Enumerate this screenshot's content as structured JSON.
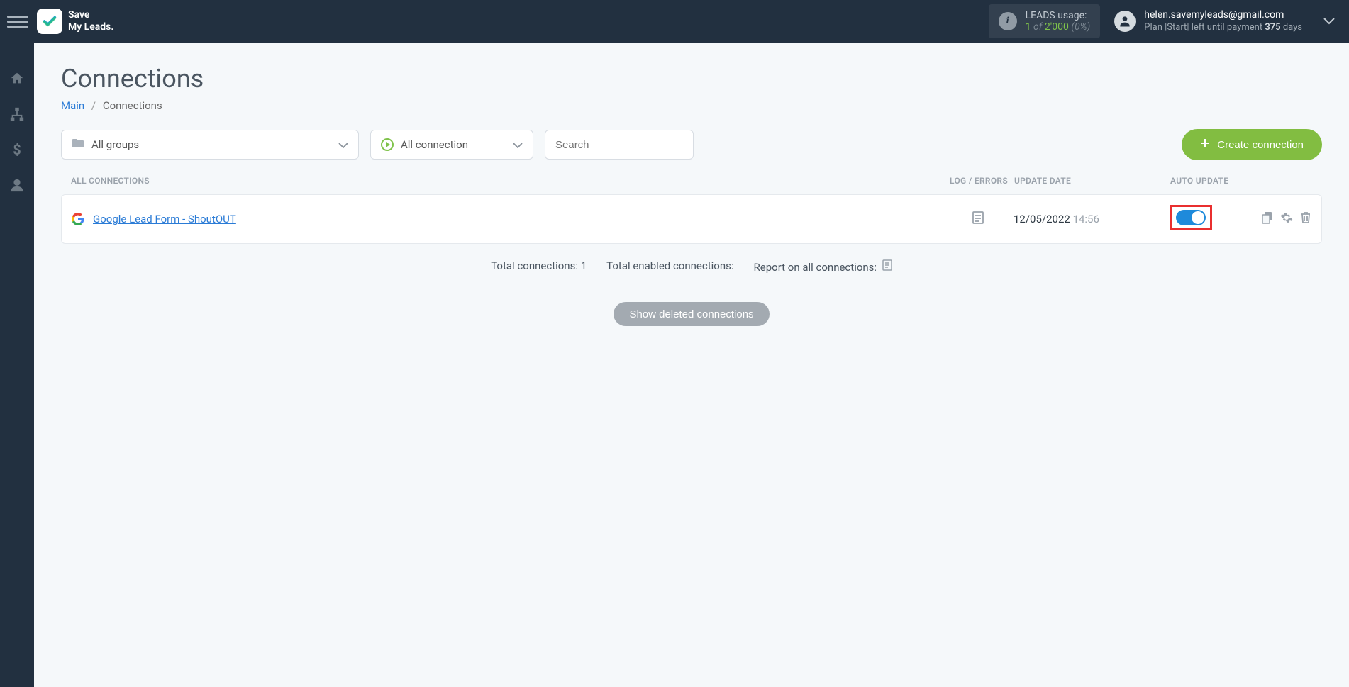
{
  "header": {
    "logo_line1": "Save",
    "logo_line2": "My Leads.",
    "usage_label": "LEADS usage:",
    "usage_count": "1",
    "usage_of": "of",
    "usage_total": "2'000",
    "usage_pct": "(0%)",
    "account_email": "helen.savemyleads@gmail.com",
    "plan_prefix": "Plan |",
    "plan_name": "Start",
    "plan_sep": "|",
    "plan_msg": " left until payment ",
    "plan_days": "375",
    "plan_days_suffix": " days"
  },
  "page": {
    "title": "Connections",
    "breadcrumb_main": "Main",
    "breadcrumb_current": "Connections"
  },
  "controls": {
    "groups_label": "All groups",
    "connection_label": "All connection",
    "search_placeholder": "Search",
    "create_label": "Create connection"
  },
  "table": {
    "col_all": "ALL CONNECTIONS",
    "col_log": "LOG / ERRORS",
    "col_date": "UPDATE DATE",
    "col_auto": "AUTO UPDATE"
  },
  "rows": [
    {
      "name": "Google Lead Form - ShoutOUT",
      "date": "12/05/2022",
      "time": "14:56"
    }
  ],
  "summary": {
    "total_label": "Total connections:",
    "total_value": "1",
    "enabled_label": "Total enabled connections:",
    "report_label": "Report on all connections:"
  },
  "show_deleted": "Show deleted connections"
}
